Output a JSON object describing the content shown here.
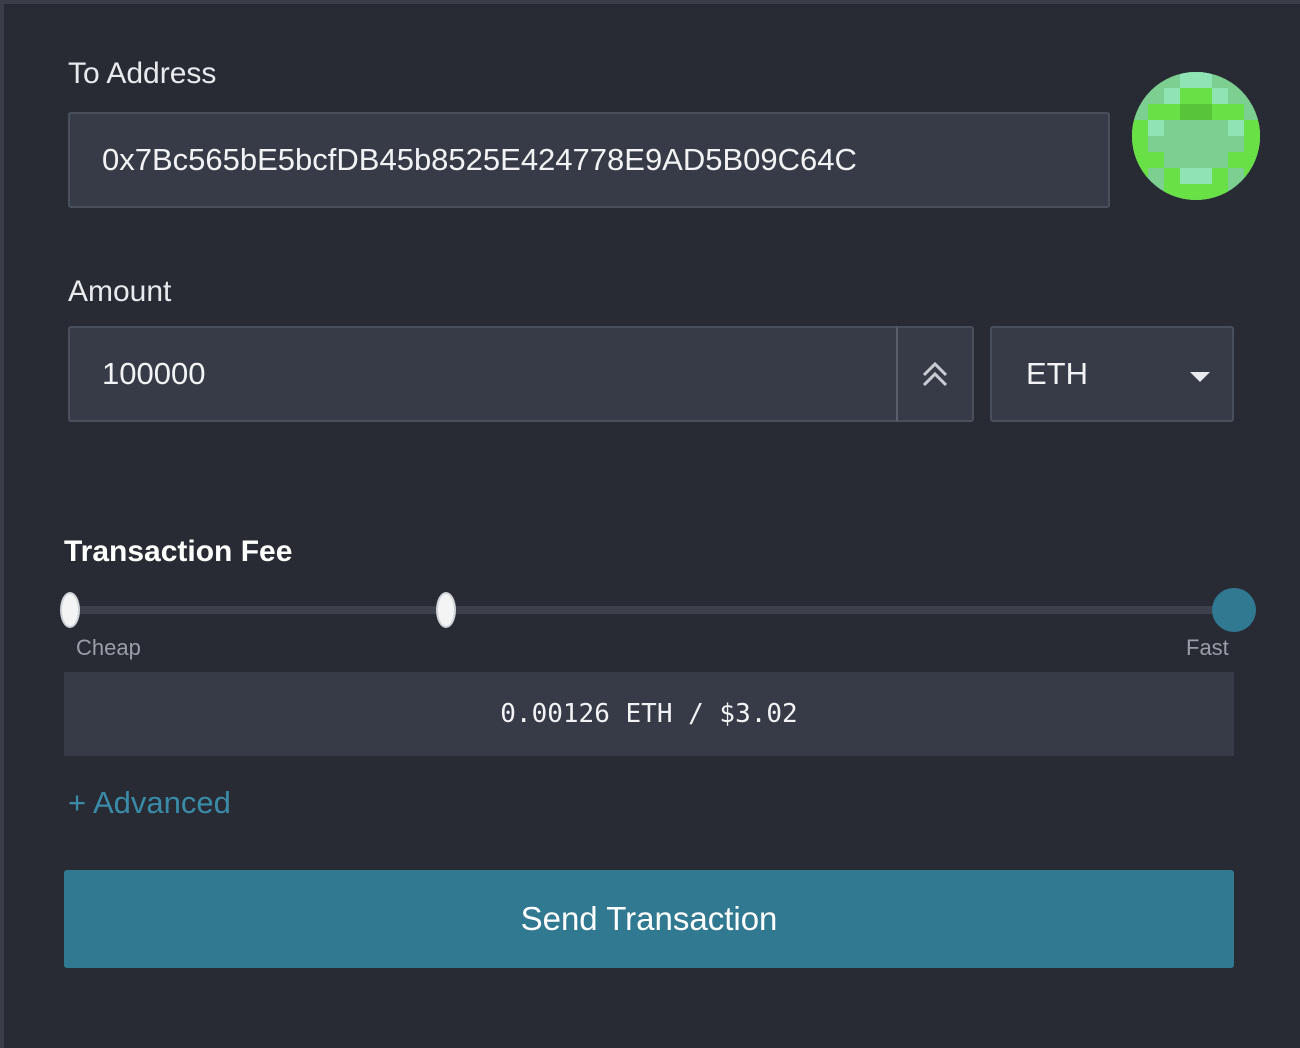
{
  "to_address": {
    "label": "To Address",
    "value": "0x7Bc565bE5bcfDB45b8525E424778E9AD5B09C64C"
  },
  "amount": {
    "label": "Amount",
    "value": "100000",
    "currency": "ETH",
    "stepper_icon": "double-chevron-up-icon",
    "dropdown_icon": "caret-down-icon"
  },
  "fee": {
    "title": "Transaction Fee",
    "min_label": "Cheap",
    "max_label": "Fast",
    "slider_level": 1.0,
    "summary": "0.00126 ETH / $3.02"
  },
  "advanced_label": "+ Advanced",
  "send_label": "Send Transaction",
  "colors": {
    "accent": "#317891",
    "link": "#3a8ba8",
    "background": "#282b33",
    "input": "#363b47"
  }
}
